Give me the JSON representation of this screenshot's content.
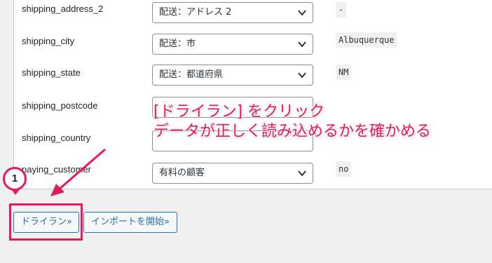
{
  "rows": [
    {
      "field": "shipping_address_2",
      "select": "配送：アドレス 2",
      "sample": "-"
    },
    {
      "field": "shipping_city",
      "select": "配送：市",
      "sample": "Albuquerque"
    },
    {
      "field": "shipping_state",
      "select": "配送：都道府県",
      "sample": "NM"
    },
    {
      "field": "shipping_postcode",
      "select": "",
      "sample": ""
    },
    {
      "field": "shipping_country",
      "select": "",
      "sample": ""
    },
    {
      "field": "paying_customer",
      "select": "有料の顧客",
      "sample": "no"
    }
  ],
  "buttons": {
    "dry_run": "ドライラン»",
    "start_import": "インポートを開始»"
  },
  "annotation": {
    "step_number": "1",
    "line1": "[ドライラン] をクリック",
    "line2": "データが正しく読み込めるかを確かめる",
    "color": "#e5195f"
  }
}
